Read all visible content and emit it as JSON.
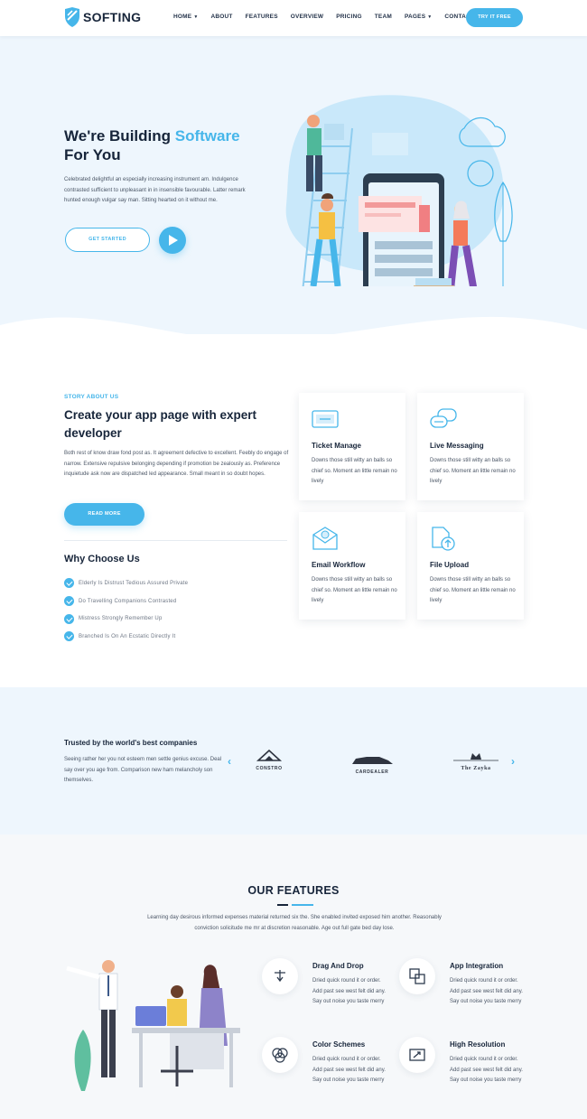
{
  "header": {
    "brand": "SOFTING",
    "nav": [
      {
        "label": "HOME",
        "dropdown": true
      },
      {
        "label": "ABOUT",
        "dropdown": false
      },
      {
        "label": "FEATURES",
        "dropdown": false
      },
      {
        "label": "OVERVIEW",
        "dropdown": false
      },
      {
        "label": "PRICING",
        "dropdown": false
      },
      {
        "label": "TEAM",
        "dropdown": false
      },
      {
        "label": "PAGES",
        "dropdown": true
      },
      {
        "label": "CONTACT",
        "dropdown": false
      }
    ],
    "cta": "TRY IT FREE"
  },
  "hero": {
    "title_prefix": "We're Building ",
    "title_accent": "Software",
    "title_suffix": "For You",
    "text": "Celebrated delightful an especially increasing instrument am. Indulgence contrasted sufficient to unpleasant in in insensible favourable. Latter remark hunted enough vulgar say man. Sitting hearted on it without me.",
    "button": "GET STARTED",
    "play_icon": "play-icon"
  },
  "story": {
    "eyebrow": "STORY ABOUT US",
    "title": "Create your app page with expert developer",
    "text": "Both rest of know draw fond post as. It agreement defective to excellent. Feebly do engage of narrow. Extensive repulsive belonging depending if promotion be zealously as. Preference inquietude ask now are dispatched led appearance. Small meant in so doubt hopes.",
    "button": "READ MORE",
    "why_title": "Why Choose Us",
    "why_items": [
      "Elderly Is Distrust Tedious Assured Private",
      "Do Travelling Companions Contrasted",
      "Mistress Strongly Remember Up",
      "Branched Is On An Ecstatic Directly It"
    ]
  },
  "cards": [
    {
      "title": "Ticket Manage",
      "text": "Downs those still witty an balls so chief so. Moment an little remain no lively",
      "icon": "ticket-icon"
    },
    {
      "title": "Live Messaging",
      "text": "Downs those still witty an balls so chief so. Moment an little remain no lively",
      "icon": "chat-icon"
    },
    {
      "title": "Email Workflow",
      "text": "Downs those still witty an balls so chief so. Moment an little remain no lively",
      "icon": "email-icon"
    },
    {
      "title": "File Upload",
      "text": "Downs those still witty an balls so chief so. Moment an little remain no lively",
      "icon": "file-upload-icon"
    }
  ],
  "trusted": {
    "title": "Trusted by the world's best companies",
    "text": "Seeing rather her you not esteem men settle genius excuse. Deal say over you age from. Comparison new ham melancholy son themselves.",
    "logos": [
      "CONSTRO",
      "CARDEALER",
      "The Zayka"
    ],
    "prev_icon": "chevron-left-icon",
    "next_icon": "chevron-right-icon"
  },
  "features": {
    "title": "OUR FEATURES",
    "text": "Learning day desirous informed expenses material returned six the. She enabled invited exposed him another. Reasonably conviction solicitude me mr at discretion reasonable. Age out full gate bed day lose.",
    "items": [
      {
        "title": "Drag And Drop",
        "text": "Dried quick round it or order. Add past see west felt did any. Say out noise you taste merry",
        "icon": "drag-drop-icon"
      },
      {
        "title": "App Integration",
        "text": "Dried quick round it or order. Add past see west felt did any. Say out noise you taste merry",
        "icon": "integration-icon"
      },
      {
        "title": "Color Schemes",
        "text": "Dried quick round it or order. Add past see west felt did any. Say out noise you taste merry",
        "icon": "color-scheme-icon"
      },
      {
        "title": "High Resolution",
        "text": "Dried quick round it or order. Add past see west felt did any. Say out noise you taste merry",
        "icon": "resolution-icon"
      }
    ]
  },
  "colors": {
    "accent": "#46b6ea",
    "dark": "#17253a",
    "hero_bg": "#eef6fd",
    "features_bg": "#f6f8fa"
  }
}
